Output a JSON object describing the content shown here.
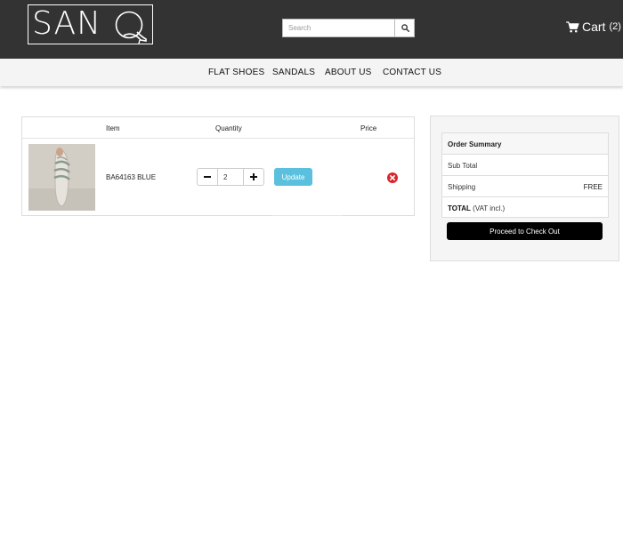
{
  "header": {
    "logo_text": "SAN",
    "logo_letter": "Q",
    "search": {
      "placeholder": "Search"
    },
    "cart": {
      "label": "Cart",
      "count": "(2)"
    }
  },
  "nav": {
    "items": [
      {
        "label": "FLAT SHOES"
      },
      {
        "label": "SANDALS"
      },
      {
        "label": "ABOUT US"
      },
      {
        "label": "CONTACT US"
      }
    ]
  },
  "cart_table": {
    "columns": {
      "item": "Item",
      "quantity": "Quantity",
      "price": "Price"
    },
    "rows": [
      {
        "sku": "BA64163 BLUE",
        "quantity": "2",
        "price": "",
        "update_label": "Update"
      }
    ]
  },
  "order_summary": {
    "title": "Order Summary",
    "subtotal_label": "Sub Total",
    "subtotal_value": "",
    "shipping_label": "Shipping",
    "shipping_value": "FREE",
    "total_label": "TOTAL",
    "total_note": "(VAT incl.)",
    "checkout_label": "Proceed to Check Out"
  },
  "colors": {
    "header_bg": "#333333",
    "nav_bg": "#f4f4f4",
    "update_button": "#5bc0de",
    "checkout_button": "#000000",
    "remove_icon": "#d9262c"
  },
  "icons": {
    "search": "search-icon",
    "cart": "shopping-cart-icon",
    "minus": "minus-icon",
    "plus": "plus-icon",
    "remove": "remove-circle-icon"
  }
}
